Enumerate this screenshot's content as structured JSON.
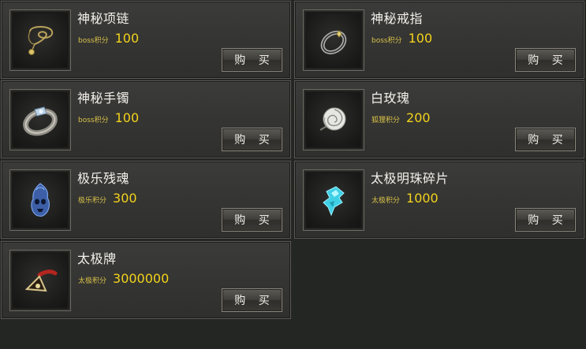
{
  "shop": {
    "buy_label": "购 买",
    "items": [
      {
        "name": "神秘项链",
        "currency": "boss积分",
        "price": "100",
        "icon": "necklace-icon"
      },
      {
        "name": "神秘戒指",
        "currency": "boss积分",
        "price": "100",
        "icon": "ring-icon"
      },
      {
        "name": "神秘手镯",
        "currency": "boss积分",
        "price": "100",
        "icon": "bracelet-icon"
      },
      {
        "name": "白玫瑰",
        "currency": "狐狸积分",
        "price": "200",
        "icon": "white-rose-icon"
      },
      {
        "name": "极乐残魂",
        "currency": "极乐积分",
        "price": "300",
        "icon": "soul-spirit-icon"
      },
      {
        "name": "太极明珠碎片",
        "currency": "太极积分",
        "price": "1000",
        "icon": "pearl-shard-icon"
      },
      {
        "name": "太极牌",
        "currency": "太极积分",
        "price": "3000000",
        "icon": "taiji-token-icon"
      }
    ]
  }
}
